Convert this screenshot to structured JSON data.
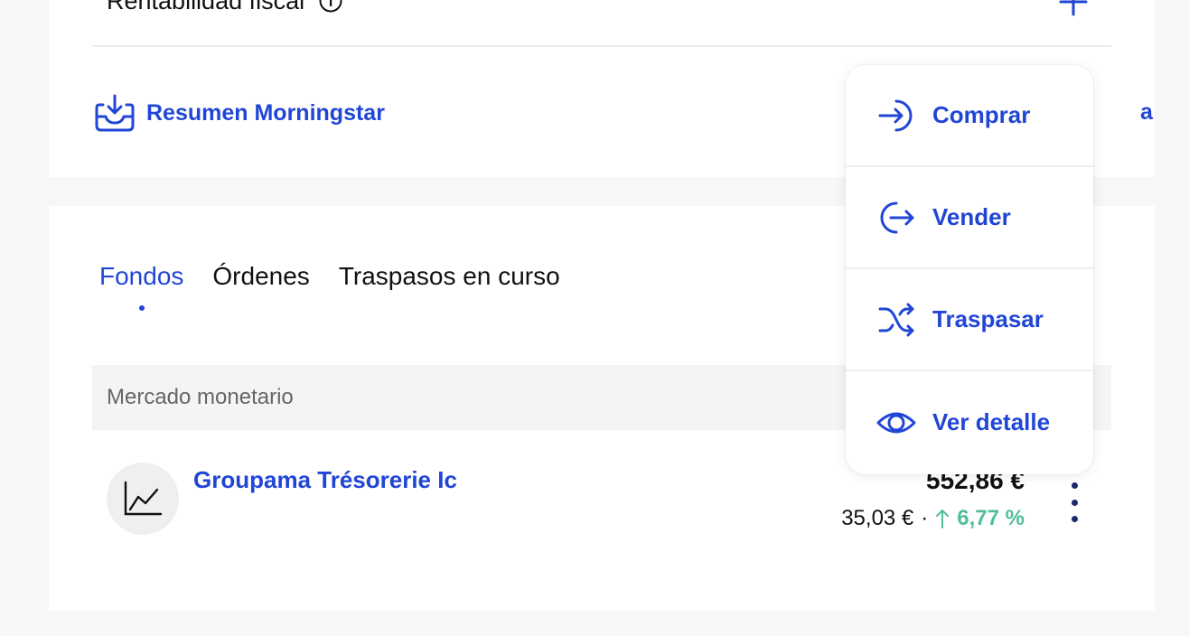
{
  "top": {
    "fiscal_label": "Rentabilidad fiscal",
    "morning_link": "Resumen Morningstar",
    "clipped_text": "a"
  },
  "tabs": [
    {
      "label": "Fondos",
      "active": true
    },
    {
      "label": "Órdenes",
      "active": false
    },
    {
      "label": "Traspasos en curso",
      "active": false
    }
  ],
  "section": {
    "title": "Mercado monetario"
  },
  "fund": {
    "name": "Groupama Trésorerie Ic",
    "value": "552,86 €",
    "gain": "35,03 €",
    "separator": "·",
    "return_pct": "6,77 %",
    "icon": "line-chart-icon"
  },
  "menu": {
    "items": [
      {
        "label": "Comprar",
        "icon": "login-arrow-icon"
      },
      {
        "label": "Vender",
        "icon": "logout-arrow-icon"
      },
      {
        "label": "Traspasar",
        "icon": "shuffle-icon"
      },
      {
        "label": "Ver detalle",
        "icon": "eye-icon"
      }
    ]
  },
  "colors": {
    "accent": "#2146d6",
    "positive": "#4fbf9a",
    "background": "#f7f7f7",
    "card": "#ffffff"
  }
}
